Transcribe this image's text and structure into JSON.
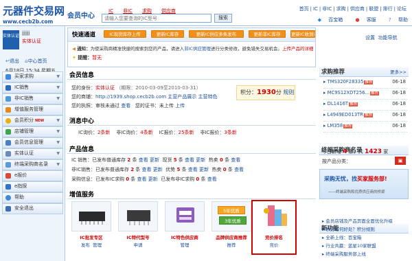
{
  "header": {
    "logo_title": "元器件交易网",
    "logo_url": "www.cecb2b.com",
    "member_center": "会员中心",
    "search_tabs": [
      "IC",
      "非IC",
      "求购",
      "供应商"
    ],
    "search_placeholder": "请输入您要查询的IC型号",
    "search_button": "搜索",
    "top_links": [
      "首页",
      "IC",
      "非IC",
      "求购",
      "供应商",
      "联盟",
      "排行",
      "论坛"
    ],
    "sub_links": [
      "百宝箱",
      "客服",
      "帮助"
    ]
  },
  "sidebar": {
    "avatar_text": "实体认证",
    "username": "jjjjjj",
    "cert": "实体认证",
    "logout": "退出",
    "home": "中心首页",
    "date": "6月18日 15:34 星期五",
    "menu": [
      {
        "label": "买家求购",
        "new": ""
      },
      {
        "label": "IC销售",
        "new": ""
      },
      {
        "label": "非IC销售",
        "new": ""
      },
      {
        "label": "增值服务管理",
        "new": ""
      },
      {
        "label": "会员积分",
        "new": "NEW"
      },
      {
        "label": "店铺管理",
        "new": ""
      },
      {
        "label": "会员信息管理",
        "new": ""
      },
      {
        "label": "实体认证",
        "new": ""
      },
      {
        "label": "终端采购商名录",
        "new": ""
      },
      {
        "label": "e报价",
        "new": ""
      },
      {
        "label": "e指探",
        "new": ""
      },
      {
        "label": "帮助",
        "new": ""
      },
      {
        "label": "安全退出",
        "new": ""
      }
    ]
  },
  "quick": {
    "title": "快速通道",
    "buttons": [
      "IC现货库存上传",
      "更新IC库存",
      "更新IC供应多条发布",
      "更新非IC库存",
      "更新IC收到的报价"
    ],
    "settings": "设置",
    "help": "功能导航",
    "notice_label": "通知：",
    "notice_text": "为使采购商精准快捷的搜索到您的产品，请进入",
    "notice_link": "非IC供应管理",
    "notice_text2": "进行分类修改，避免错失交易机会。",
    "notice_link2": "上传产品的详细分类有何作用?",
    "remind_label": "提醒：",
    "remind_text": "暂无"
  },
  "member": {
    "title": "会员信息",
    "identity_label": "您的身份：",
    "identity_value": "实体认证",
    "period": "（期限：2010-03-09至2010-03-31）",
    "shop_label": "您的商铺：",
    "shop_url": "http://1939.shop.cecb2b.com",
    "shop_links": [
      "主营产品展示",
      "主营特色"
    ],
    "license_label": "您的执照：",
    "license_value": "审核未通过",
    "license_link": "查看",
    "cert_label": "您的证书：",
    "cert_value": "未上传",
    "cert_link": "上传",
    "points_label": "积分：",
    "points_value": "1930",
    "points_unit": "分",
    "points_rule": "规则"
  },
  "messages": {
    "title": "消息中心",
    "items": [
      {
        "label": "IC询价：",
        "count": "2条新"
      },
      {
        "label": "非IC询价：",
        "count": "4条新"
      },
      {
        "label": "IC报价：",
        "count": "25条新"
      },
      {
        "label": "非IC报价：",
        "count": "3条新"
      }
    ]
  },
  "products": {
    "title": "产品信息",
    "rows": [
      {
        "name": "IC 销售：",
        "pub": "已发布普通库存",
        "n1": "2",
        "unit": "条",
        "a": "查看",
        "b": "更新",
        "s1": "现货",
        "n2": "5",
        "c": "条",
        "d": "查看",
        "e": "更新",
        "s2": "热卖",
        "n3": "0",
        "f": "条",
        "g": "查看"
      },
      {
        "name": "非IC销售：",
        "pub": "已发布普通库存",
        "n1": "2",
        "unit": "条",
        "a": "查看",
        "b": "更新",
        "s1": "优势",
        "n2": "5",
        "c": "条",
        "d": "查看",
        "e": "更新",
        "s2": "热卖",
        "n3": "0",
        "f": "条",
        "g": "查看"
      },
      {
        "name": "采购信息：",
        "pub": "已发布IC求购",
        "n1": "0",
        "unit": "条",
        "a": "查看",
        "b": "更新",
        "s1": "已发布非IC求购",
        "n2": "0",
        "c": "条",
        "d": "查看",
        "e": "",
        "s2": "",
        "n3": "",
        "f": "",
        "g": ""
      }
    ]
  },
  "services": {
    "title": "增值服务",
    "items": [
      {
        "t1": "IC批发专区",
        "t2a": "发布",
        "t2b": "管理"
      },
      {
        "t1": "IC特代型号",
        "t2a": "申请",
        "t2b": ""
      },
      {
        "t1": "IC特色供应商",
        "t2a": "管理",
        "t2b": ""
      },
      {
        "t1": "品牌供应商推荐",
        "t2a": "推荐",
        "t2b": ""
      },
      {
        "t1": "竞价排名",
        "t2a": "竞价",
        "t2b": ""
      }
    ],
    "badge_years": [
      "5年优质",
      "3年优质"
    ]
  },
  "right": {
    "purchase_title": "求购推荐",
    "more": "更多>>",
    "purchases": [
      {
        "model": "TMS320F28335",
        "date": "06-18"
      },
      {
        "model": "MC9S12XDT256...",
        "date": "06-18"
      },
      {
        "model": "DL1416T",
        "date": "06-18"
      },
      {
        "model": "L4949ED013TR",
        "date": "06-18"
      },
      {
        "model": "LM358",
        "date": "06-18"
      }
    ],
    "tui": "推荐",
    "buyers_title": "终端采购商名录",
    "today_label": "今日新增",
    "today_value": "4",
    "total_label": "家，共",
    "total_value": "1423",
    "total_unit": "家",
    "search_label": "按产品分类：",
    "banner_line1a": "采购无忧，找",
    "banner_line1b": "买家服务部!",
    "banner_line2": "——终端采购和优质供应商的桥梁",
    "newfunc_title": "新功能",
    "newfunc": [
      "会员店铺及产品页面全面优化升级",
      "积分有何好处？积分规则",
      "全新上线：百宝箱",
      "行业共赢：蓝星10家联盟",
      "终端采购服务部上线"
    ]
  },
  "colors": {
    "brand": "#1d55a8",
    "accent": "#f19019",
    "alert": "#d40000"
  }
}
